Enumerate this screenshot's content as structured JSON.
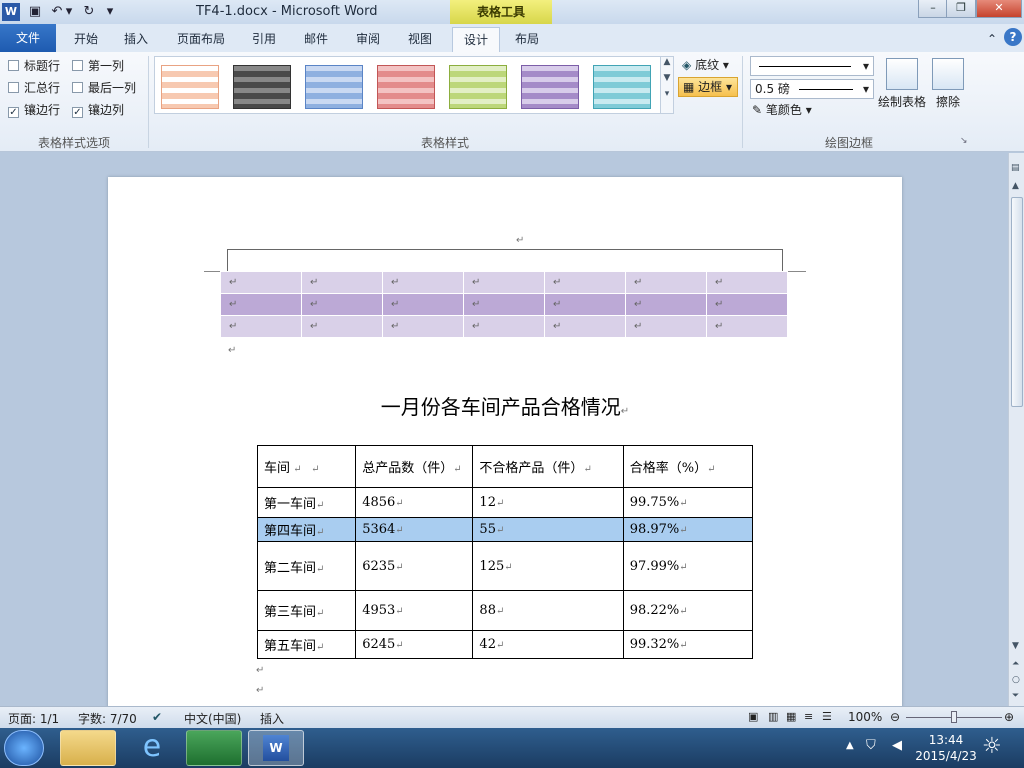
{
  "app": {
    "window_title": "TF4-1.docx - Microsoft Word",
    "context_tab_group": "表格工具",
    "tabs": [
      "文件",
      "开始",
      "插入",
      "页面布局",
      "引用",
      "邮件",
      "审阅",
      "视图",
      "设计",
      "布局"
    ],
    "active_tab": "设计"
  },
  "ribbon": {
    "options_group": {
      "label": "表格样式选项",
      "checkboxes": [
        {
          "label": "标题行",
          "checked": false
        },
        {
          "label": "第一列",
          "checked": false
        },
        {
          "label": "汇总行",
          "checked": false
        },
        {
          "label": "最后一列",
          "checked": false
        },
        {
          "label": "镶边行",
          "checked": true
        },
        {
          "label": "镶边列",
          "checked": true
        }
      ]
    },
    "styles_group": {
      "label": "表格样式",
      "swatch_colors": [
        "#f7c9b1",
        "#4a4a4a",
        "#8fb0e0",
        "#e38c8c",
        "#bcd77a",
        "#a58bc8",
        "#7fcbd7"
      ],
      "shading_label": "底纹",
      "borders_label": "边框"
    },
    "draw_group": {
      "label": "绘图边框",
      "line_weight": "0.5 磅",
      "pen_color_label": "笔颜色",
      "draw_table_label": "绘制表格",
      "eraser_label": "擦除"
    }
  },
  "document": {
    "return_mark": "↵",
    "title": "一月份各车间产品合格情况",
    "table": {
      "headers": [
        "车间",
        "总产品数（件）",
        "不合格产品（件）",
        "合格率（%）"
      ],
      "rows": [
        [
          "第一车间",
          "4856",
          "12",
          "99.75%"
        ],
        [
          "第四车间",
          "5364",
          "55",
          "98.97%"
        ],
        [
          "第二车间",
          "6235",
          "125",
          "97.99%"
        ],
        [
          "第三车间",
          "4953",
          "88",
          "98.22%"
        ],
        [
          "第五车间",
          "6245",
          "42",
          "99.32%"
        ]
      ],
      "selected_row": 1
    }
  },
  "status": {
    "page": "页面: 1/1",
    "words": "字数: 7/70",
    "language": "中文(中国)",
    "mode": "插入",
    "zoom": "100%"
  },
  "taskbar": {
    "time": "13:44",
    "date": "2015/4/23"
  }
}
